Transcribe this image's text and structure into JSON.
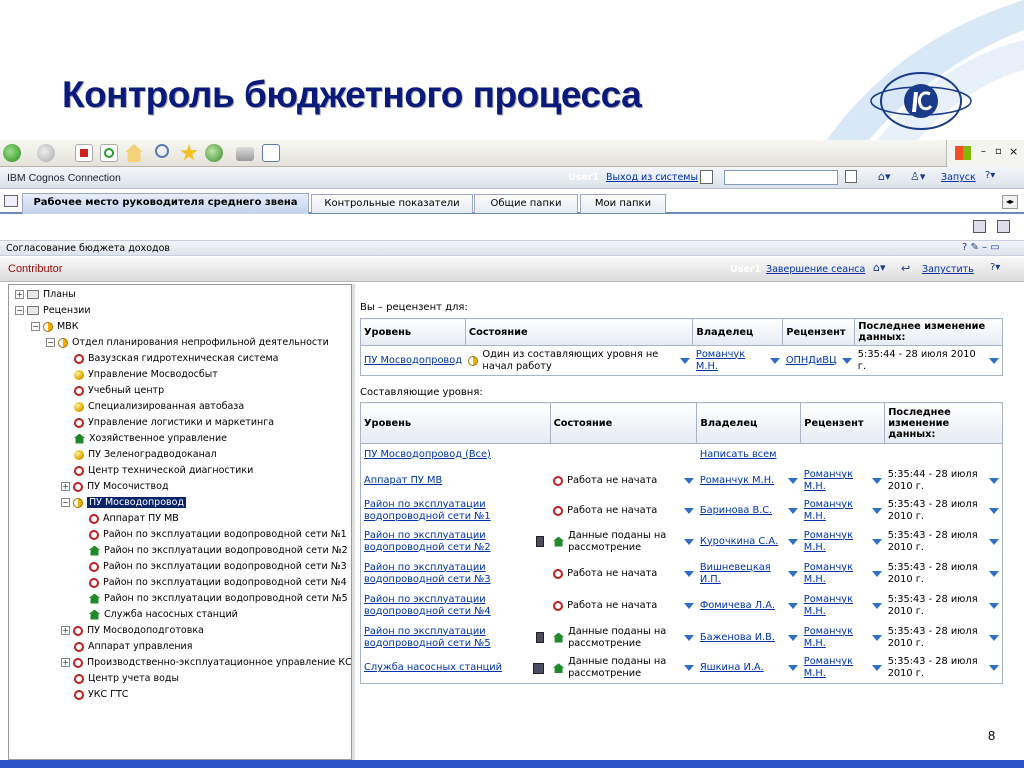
{
  "slide": {
    "title": "Контроль бюджетного процесса",
    "page_number": "8"
  },
  "browser": {
    "toolbar_icons": [
      "back-icon",
      "forward-icon",
      "stop-icon",
      "refresh-icon",
      "home-icon",
      "search-icon",
      "favorites-icon",
      "history-icon",
      "print-icon",
      "edit-icon"
    ]
  },
  "cognos": {
    "brand": "IBM Cognos Connection",
    "user": "User1",
    "logout": "Выход из системы",
    "launch": "Запуск",
    "tabs": [
      "Рабочее место руководителя среднего звена",
      "Контрольные показатели",
      "Общие папки",
      "Мои папки"
    ]
  },
  "portlet": {
    "title": "Согласование бюджета доходов"
  },
  "contributor": {
    "title": "Contributor",
    "user": "User1",
    "end_session": "Завершение сеанса",
    "launch": "Запустить"
  },
  "tree": [
    {
      "label": "Планы"
    },
    {
      "label": "Рецензии"
    },
    {
      "label": "МВК"
    },
    {
      "label": "Отдел планирования непрофильной деятельности"
    },
    {
      "label": "Вазузская гидротехническая система"
    },
    {
      "label": "Управление Мосводосбыт"
    },
    {
      "label": "Учебный центр"
    },
    {
      "label": "Специализированная автобаза"
    },
    {
      "label": "Управление логистики и маркетинга"
    },
    {
      "label": "Хозяйственное управление"
    },
    {
      "label": "ПУ Зеленоградводоканал"
    },
    {
      "label": "Центр технической диагностики"
    },
    {
      "label": "ПУ Мосочиствод"
    },
    {
      "label": "ПУ Мосводопровод"
    },
    {
      "label": "Аппарат ПУ МВ"
    },
    {
      "label": "Район по эксплуатации водопроводной сети №1"
    },
    {
      "label": "Район по эксплуатации водопроводной сети №2"
    },
    {
      "label": "Район по эксплуатации водопроводной сети №3"
    },
    {
      "label": "Район по эксплуатации водопроводной сети №4"
    },
    {
      "label": "Район по эксплуатации водопроводной сети №5"
    },
    {
      "label": "Служба насосных станций"
    },
    {
      "label": "ПУ Мосводоподготовка"
    },
    {
      "label": "Аппарат управления"
    },
    {
      "label": "Производственно-эксплуатационное управление КС"
    },
    {
      "label": "Центр учета воды"
    },
    {
      "label": "УКС ГТС"
    }
  ],
  "reviewer": {
    "caption": "Вы – рецензент для:",
    "headers": [
      "Уровень",
      "Состояние",
      "Владелец",
      "Рецензент",
      "Последнее изменение данных:"
    ],
    "row": {
      "level": "ПУ Мосводопровод",
      "state": "Один из составляющих уровня не начал работу",
      "owner": "Романчук М.Н.",
      "reviewer": "ОПНДиВЦ",
      "modified": "5:35:44 - 28 июля 2010 г."
    }
  },
  "components": {
    "caption": "Составляющие уровня:",
    "headers": [
      "Уровень",
      "Состояние",
      "Владелец",
      "Рецензент",
      "Последнее изменение данных:"
    ],
    "all_label": "ПУ Мосводопровод (Все)",
    "write_all": "Написать всем",
    "rows": [
      {
        "level": "Аппарат ПУ МВ",
        "state": "Работа не начата",
        "owner": "Романчук М.Н.",
        "reviewer": "Романчук М.Н.",
        "modified": "5:35:44 - 28 июля 2010 г."
      },
      {
        "level": "Район по эксплуатации водопроводной сети №1",
        "state": "Работа не начата",
        "owner": "Баринова В.С.",
        "reviewer": "Романчук М.Н.",
        "modified": "5:35:43 - 28 июля 2010 г."
      },
      {
        "level": "Район по эксплуатации водопроводной сети №2",
        "state": "Данные поданы на рассмотрение",
        "owner": "Курочкина С.А.",
        "reviewer": "Романчук М.Н.",
        "modified": "5:35:43 - 28 июля 2010 г."
      },
      {
        "level": "Район по эксплуатации водопроводной сети №3",
        "state": "Работа не начата",
        "owner": "Вишневецкая И.П.",
        "reviewer": "Романчук М.Н.",
        "modified": "5:35:43 - 28 июля 2010 г."
      },
      {
        "level": "Район по эксплуатации водопроводной сети №4",
        "state": "Работа не начата",
        "owner": "Фомичева Л.А.",
        "reviewer": "Романчук М.Н.",
        "modified": "5:35:43 - 28 июля 2010 г."
      },
      {
        "level": "Район по эксплуатации водопроводной сети №5",
        "state": "Данные поданы на рассмотрение",
        "owner": "Баженова И.В.",
        "reviewer": "Романчук М.Н.",
        "modified": "5:35:43 - 28 июля 2010 г."
      },
      {
        "level": "Служба насосных станций",
        "state": "Данные поданы на рассмотрение",
        "owner": "Яшкина И.А.",
        "reviewer": "Романчук М.Н.",
        "modified": "5:35:43 - 28 июля 2010 г."
      }
    ]
  },
  "colors": {
    "title": "#0a1a7a",
    "tab_active": "#c4d2ec",
    "link": "#0033aa",
    "selected": "#0a246a"
  }
}
